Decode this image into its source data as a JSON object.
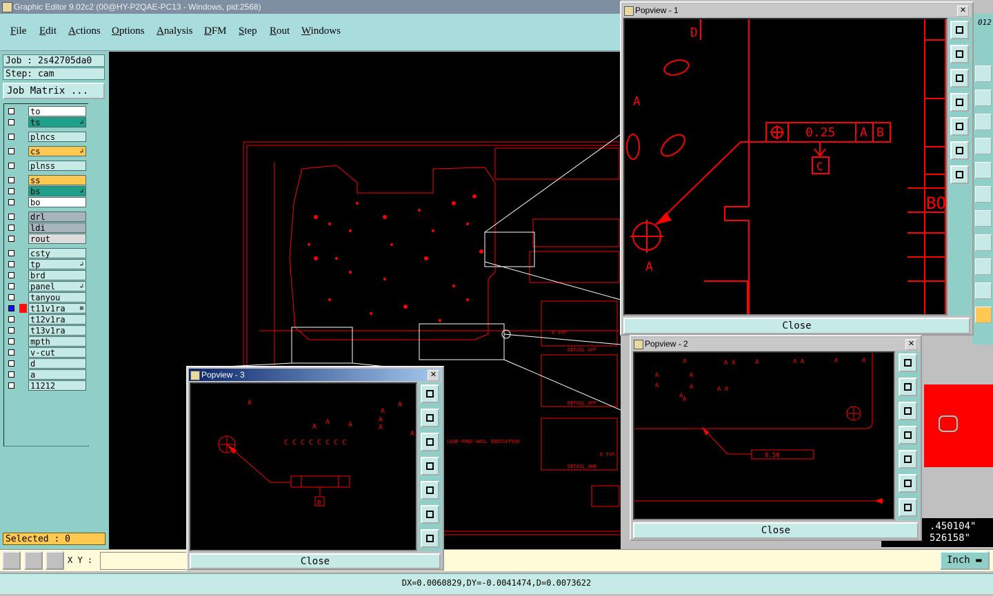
{
  "window": {
    "title": "Graphic Editor 9.02c2 (00@HY-P2QAE-PC13 - Windows, pid:2568)"
  },
  "menu": {
    "items": [
      "File",
      "Edit",
      "Actions",
      "Options",
      "Analysis",
      "DFM",
      "Step",
      "Rout",
      "Windows"
    ]
  },
  "job": {
    "job_label": "Job : 2s42705da0",
    "step_label": "Step: cam",
    "matrix_button": "Job Matrix ..."
  },
  "layers": [
    {
      "name": "to",
      "color": "#ffffff"
    },
    {
      "name": "ts",
      "color": "#1fa08a",
      "mark": "↲"
    },
    {
      "name": "plncs",
      "color": "#c6ebe6"
    },
    {
      "name": "cs",
      "color": "#ffc850",
      "mark": "↲"
    },
    {
      "name": "plnss",
      "color": "#c6ebe6"
    },
    {
      "name": "ss",
      "color": "#ffc850"
    },
    {
      "name": "bs",
      "color": "#1fa08a",
      "mark": "↲"
    },
    {
      "name": "bo",
      "color": "#ffffff"
    },
    {
      "name": "drl",
      "color": "#a8b4bc"
    },
    {
      "name": "ldi",
      "color": "#a8b4bc"
    },
    {
      "name": "rout",
      "color": "#dcdcdc"
    },
    {
      "name": "csty",
      "color": "#c6ebe6"
    },
    {
      "name": "tp",
      "color": "#c6ebe6",
      "mark": "↲"
    },
    {
      "name": "brd",
      "color": "#c6ebe6"
    },
    {
      "name": "panel",
      "color": "#c6ebe6",
      "mark": "↲"
    },
    {
      "name": "tanyou",
      "color": "#c6ebe6"
    },
    {
      "name": "t11v1ra",
      "color": "#c6ebe6",
      "active": true,
      "mark": "⊞"
    },
    {
      "name": "t12v1ra",
      "color": "#c6ebe6"
    },
    {
      "name": "t13v1ra",
      "color": "#c6ebe6"
    },
    {
      "name": "mpth",
      "color": "#c6ebe6"
    },
    {
      "name": "v-cut",
      "color": "#c6ebe6"
    },
    {
      "name": "d",
      "color": "#c6ebe6"
    },
    {
      "name": "a",
      "color": "#c6ebe6"
    },
    {
      "name": "11212",
      "color": "#c6ebe6"
    }
  ],
  "selected": "Selected : 0",
  "bottom": {
    "xy_label": "X Y :",
    "unit": "Inch"
  },
  "coords": {
    "line1": ".450104\"",
    "line2": "526158\""
  },
  "right_strip_text": "012",
  "status": "DX=0.0060829,DY=-0.0041474,D=0.0073622",
  "popview1": {
    "title": "Popview - 1",
    "close": "Close",
    "labels": {
      "d": "D",
      "a1": "A",
      "a2": "A",
      "tol": "0.25",
      "ref_a": "A",
      "ref_b": "B",
      "ref_c": "C",
      "bo": "BO"
    }
  },
  "popview2": {
    "title": "Popview - 2",
    "close": "Close",
    "tol": "0.50"
  },
  "popview3": {
    "title": "Popview - 3",
    "close": "Close",
    "c_row": "C C C C C C C C",
    "ref_b": "B"
  },
  "drawing": {
    "notes": [
      "LEAD-FREE HASL INDICATION",
      "DETAIL_AFF",
      "DETAIL_AFF",
      "DETAIL_AHB",
      "R TYP",
      "R TYP"
    ]
  },
  "colors": {
    "drawing": "#ff0000",
    "panel": "#8fcfc8",
    "highlight": "#ffc850"
  }
}
